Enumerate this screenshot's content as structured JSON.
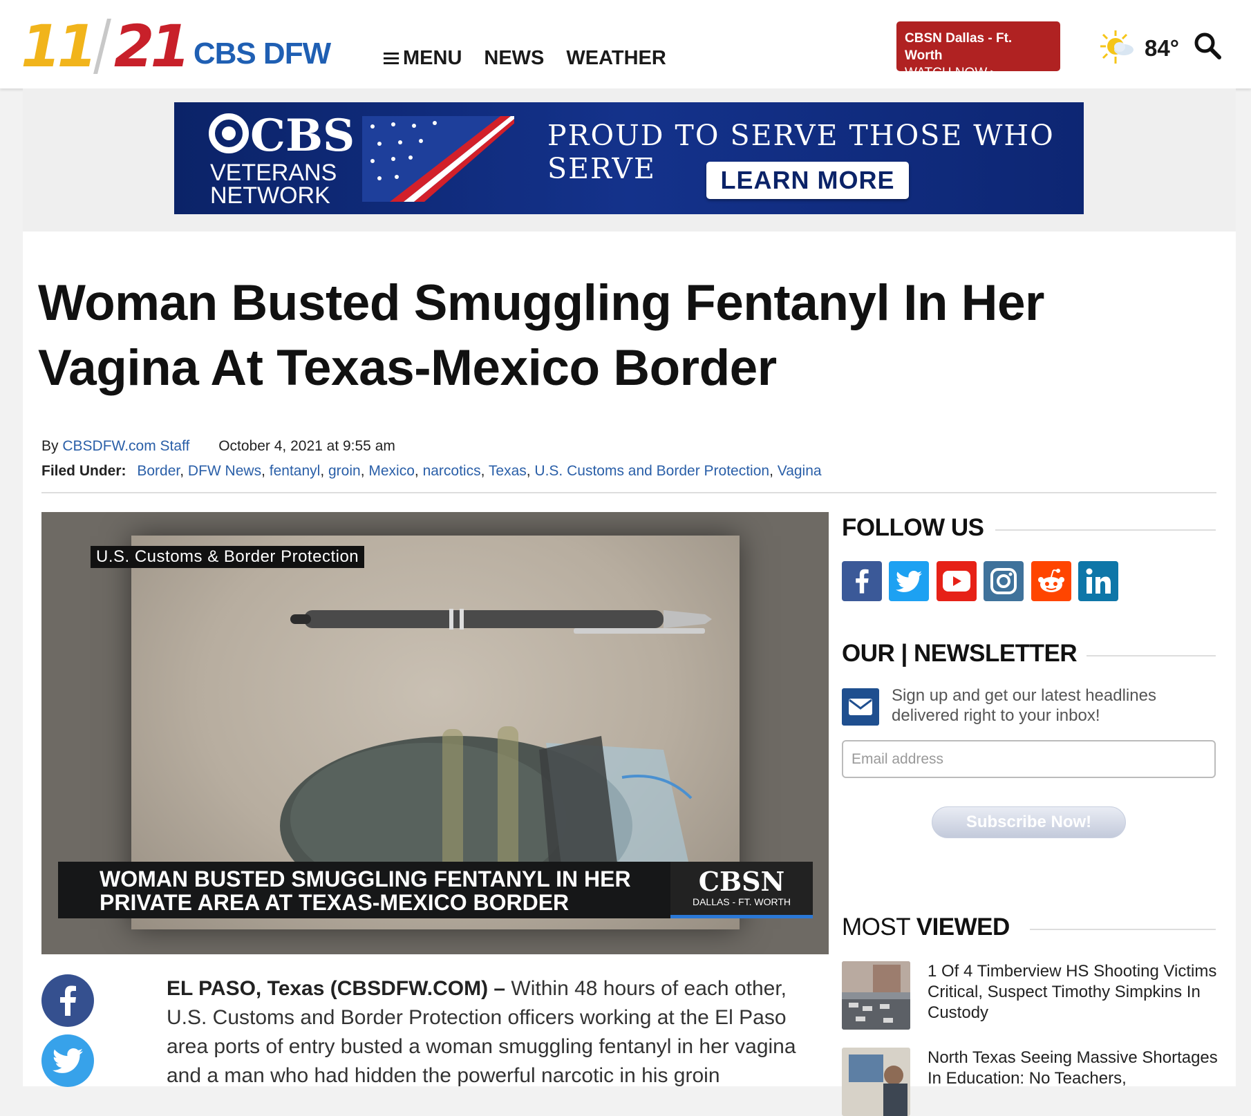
{
  "header": {
    "logo_11": "11",
    "logo_21": "21",
    "logo_brand": "CBS DFW",
    "nav": [
      {
        "label": "MENU"
      },
      {
        "label": "NEWS"
      },
      {
        "label": "WEATHER"
      }
    ],
    "watch": {
      "line1": "CBSN Dallas - Ft. Worth",
      "line2": "WATCH NOW ▸"
    },
    "weather": {
      "temp": "84°",
      "icon": "partly-sunny-icon"
    },
    "search_icon": "search-icon"
  },
  "ad": {
    "brand": "CBS",
    "sub1": "VETERANS",
    "sub2": "NETWORK",
    "tagline": "PROUD TO SERVE THOSE WHO SERVE",
    "cta": "LEARN MORE"
  },
  "article": {
    "headline": "Woman Busted Smuggling Fentanyl In Her Vagina At Texas-Mexico Border",
    "by_prefix": "By",
    "author": "CBSDFW.com Staff",
    "date": "October 4, 2021 at 9:55 am",
    "filed_label": "Filed Under:",
    "tags": [
      "Border",
      "DFW News",
      "fentanyl",
      "groin",
      "Mexico",
      "narcotics",
      "Texas",
      "U.S. Customs and Border Protection",
      "Vagina"
    ],
    "video": {
      "source_label": "U.S. Customs & Border Protection",
      "lower_third_line1": "WOMAN BUSTED SMUGGLING FENTANYL IN HER",
      "lower_third_line2": "PRIVATE AREA AT TEXAS-MEXICO BORDER",
      "brand": "CBSN",
      "brand_sub": "DALLAS - FT. WORTH"
    },
    "lead_bold": "EL PASO, Texas (CBSDFW.COM) –",
    "lead_text": " Within 48 hours of each other, U.S. Customs and Border Protection officers working at the El Paso area ports of entry busted a woman smuggling fentanyl in her vagina and a man who had hidden the powerful narcotic in his groin"
  },
  "sidebar": {
    "follow_title": "FOLLOW US",
    "social": [
      "facebook-icon",
      "twitter-icon",
      "youtube-icon",
      "instagram-icon",
      "reddit-icon",
      "linkedin-icon"
    ],
    "newsletter_title": "OUR | NEWSLETTER",
    "newsletter_text": "Sign up and get our latest headlines delivered right to your inbox!",
    "email_placeholder": "Email address",
    "subscribe_label": "Subscribe Now!",
    "most_viewed_light": "MOST",
    "most_viewed_bold": "VIEWED",
    "most_viewed": [
      {
        "title": "1 Of 4 Timberview HS Shooting Victims Critical, Suspect Timothy Simpkins In Custody"
      },
      {
        "title": "North Texas Seeing Massive Shortages In Education: No Teachers,"
      }
    ]
  },
  "colors": {
    "accent_blue": "#2a5fa8",
    "watch_red": "#b02222",
    "ad_navy": "#0b2368",
    "facebook": "#3b5998",
    "twitter": "#1da1f2",
    "youtube": "#e62117",
    "instagram": "#3f729b",
    "reddit": "#ff4500",
    "linkedin": "#0e76a8"
  }
}
